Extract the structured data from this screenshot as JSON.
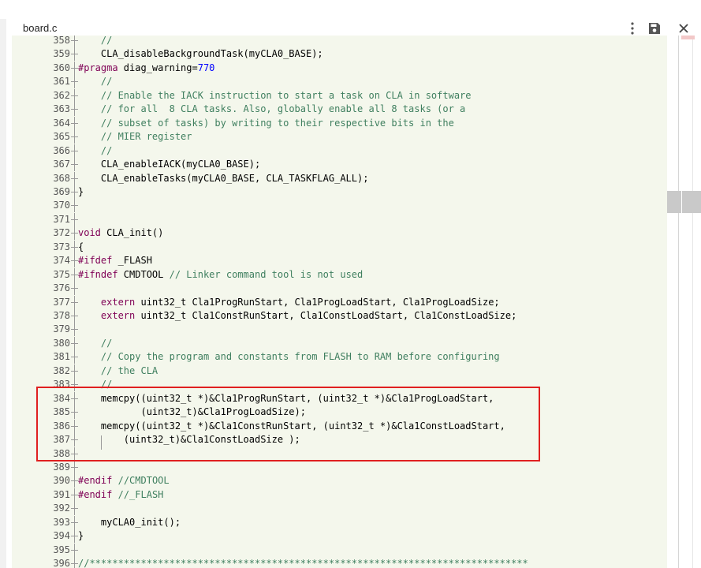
{
  "tab": {
    "filename": "board.c"
  },
  "icons": {
    "menu": "more-vert-icon",
    "save": "save-icon",
    "close": "close-icon"
  },
  "colors": {
    "background": "#f4f7ec",
    "keyword": "#7f0055",
    "comment": "#3f7f5f",
    "number": "#0000ff",
    "highlight_box": "#e02020"
  },
  "code_lines": [
    {
      "n": "358",
      "text": "    //"
    },
    {
      "n": "359",
      "text": "    CLA_disableBackgroundTask(myCLA0_BASE);"
    },
    {
      "n": "360",
      "text": "#pragma diag_warning=770"
    },
    {
      "n": "361",
      "text": "    //"
    },
    {
      "n": "362",
      "text": "    // Enable the IACK instruction to start a task on CLA in software"
    },
    {
      "n": "363",
      "text": "    // for all  8 CLA tasks. Also, globally enable all 8 tasks (or a"
    },
    {
      "n": "364",
      "text": "    // subset of tasks) by writing to their respective bits in the"
    },
    {
      "n": "365",
      "text": "    // MIER register"
    },
    {
      "n": "366",
      "text": "    //"
    },
    {
      "n": "367",
      "text": "    CLA_enableIACK(myCLA0_BASE);"
    },
    {
      "n": "368",
      "text": "    CLA_enableTasks(myCLA0_BASE, CLA_TASKFLAG_ALL);"
    },
    {
      "n": "369",
      "text": "}"
    },
    {
      "n": "370",
      "text": ""
    },
    {
      "n": "371",
      "text": ""
    },
    {
      "n": "372",
      "text": "void CLA_init()"
    },
    {
      "n": "373",
      "text": "{"
    },
    {
      "n": "374",
      "text": "#ifdef _FLASH"
    },
    {
      "n": "375",
      "text": "#ifndef CMDTOOL // Linker command tool is not used"
    },
    {
      "n": "376",
      "text": ""
    },
    {
      "n": "377",
      "text": "    extern uint32_t Cla1ProgRunStart, Cla1ProgLoadStart, Cla1ProgLoadSize;"
    },
    {
      "n": "378",
      "text": "    extern uint32_t Cla1ConstRunStart, Cla1ConstLoadStart, Cla1ConstLoadSize;"
    },
    {
      "n": "379",
      "text": ""
    },
    {
      "n": "380",
      "text": "    //"
    },
    {
      "n": "381",
      "text": "    // Copy the program and constants from FLASH to RAM before configuring"
    },
    {
      "n": "382",
      "text": "    // the CLA"
    },
    {
      "n": "383",
      "text": "    //"
    },
    {
      "n": "384",
      "text": "    memcpy((uint32_t *)&Cla1ProgRunStart, (uint32_t *)&Cla1ProgLoadStart,"
    },
    {
      "n": "385",
      "text": "           (uint32_t)&Cla1ProgLoadSize);"
    },
    {
      "n": "386",
      "text": "    memcpy((uint32_t *)&Cla1ConstRunStart, (uint32_t *)&Cla1ConstLoadStart,"
    },
    {
      "n": "387",
      "text": "        (uint32_t)&Cla1ConstLoadSize );"
    },
    {
      "n": "388",
      "text": ""
    },
    {
      "n": "389",
      "text": ""
    },
    {
      "n": "390",
      "text": "#endif //CMDTOOL"
    },
    {
      "n": "391",
      "text": "#endif //_FLASH"
    },
    {
      "n": "392",
      "text": ""
    },
    {
      "n": "393",
      "text": "    myCLA0_init();"
    },
    {
      "n": "394",
      "text": "}"
    },
    {
      "n": "395",
      "text": ""
    },
    {
      "n": "396",
      "text": "//*****************************************************************************"
    }
  ]
}
